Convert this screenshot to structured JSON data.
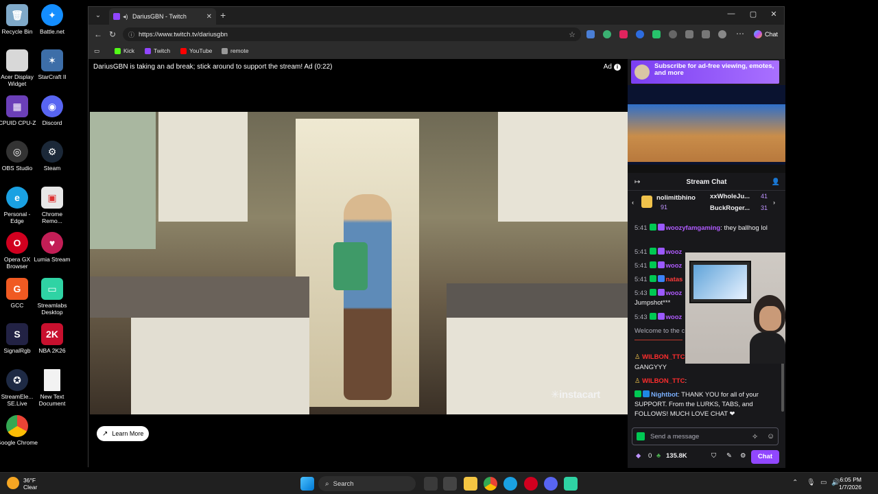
{
  "desktop": {
    "icons": [
      {
        "label": "Recycle Bin",
        "color": "#7fa9c9"
      },
      {
        "label": "Battle.net",
        "color": "#148eff"
      },
      {
        "label": "Acer Display Widget",
        "color": "#d8d8d8"
      },
      {
        "label": "StarCraft II",
        "color": "#3d6ea8"
      },
      {
        "label": "CPUID CPU-Z",
        "color": "#6b3fb8"
      },
      {
        "label": "Discord",
        "color": "#5865f2"
      },
      {
        "label": "OBS Studio",
        "color": "#333333"
      },
      {
        "label": "Steam",
        "color": "#1b2838"
      },
      {
        "label": "Personal - Edge",
        "color": "#1aa1e2"
      },
      {
        "label": "Chrome Remo...",
        "color": "#e8e8e8"
      },
      {
        "label": "Opera GX Browser",
        "color": "#d1001f"
      },
      {
        "label": "Lumia Stream",
        "color": "#c21e56"
      },
      {
        "label": "GCC",
        "color": "#f05a22"
      },
      {
        "label": "Streamlabs Desktop",
        "color": "#2fd3a4"
      },
      {
        "label": "SignalRgb",
        "color": "#222244"
      },
      {
        "label": "NBA 2K26",
        "color": "#c8102e"
      },
      {
        "label": "StreamEle... SE.Live",
        "color": "#1e2a44"
      },
      {
        "label": "New Text Document",
        "color": "#f2f2f2"
      },
      {
        "label": "Google Chrome",
        "color": "#1a73e8"
      }
    ]
  },
  "browser": {
    "tab_title": "DariusGBN - Twitch",
    "url": "https://www.twitch.tv/dariusgbn",
    "chat_button": "Chat",
    "bookmarks": [
      {
        "label": "Kick",
        "color": "#53fc18"
      },
      {
        "label": "Twitch",
        "color": "#9146ff"
      },
      {
        "label": "YouTube",
        "color": "#ff0000"
      },
      {
        "label": "remote",
        "color": "#999999"
      }
    ]
  },
  "player": {
    "ad_message": "DariusGBN is taking an ad break; stick around to support the stream! Ad (0:22)",
    "ad_label": "Ad",
    "brand": "✳instacart",
    "learn_more": "Learn More"
  },
  "chat": {
    "subscribe_banner": "Subscribe for ad-free viewing, emotes, and more",
    "header": "Stream Chat",
    "leaderboard": {
      "top": {
        "name": "nolimitbhino",
        "count": "91"
      },
      "second": {
        "name": "xxWholeJu...",
        "count": "41"
      },
      "third": {
        "name": "BuckRoger...",
        "count": "31"
      }
    },
    "messages": [
      {
        "time": "5:41",
        "user": "woozyfamgaming",
        "text": ": they ballhog lol",
        "color": "#b05bff"
      },
      {
        "time": "5:41",
        "user": "wooz",
        "text": "",
        "color": "#b05bff"
      },
      {
        "time": "5:41",
        "user": "wooz",
        "text": "",
        "color": "#b05bff"
      },
      {
        "time": "5:41",
        "user": "natas",
        "text": "",
        "color": "#ff3b3b"
      },
      {
        "time": "5:43",
        "user": "wooz",
        "text": "",
        "color": "#b05bff"
      },
      {
        "time": "",
        "user": "",
        "text": "Jumpshot***",
        "color": "#efeff1"
      },
      {
        "time": "5:43",
        "user": "wooz",
        "text": "",
        "color": "#b05bff"
      },
      {
        "time": "",
        "user": "",
        "text": "Welcome to the c",
        "color": "#adadb8"
      },
      {
        "time": "",
        "user": "WILBON_TTC",
        "text": "",
        "color": "#ff2d2d"
      },
      {
        "time": "",
        "user": "",
        "text": "GANGYYY",
        "color": "#efeff1"
      },
      {
        "time": "",
        "user": "WILBON_TTC",
        "text": ":",
        "color": "#ff2d2d"
      },
      {
        "time": "",
        "user": "Nightbot",
        "text": ": THANK YOU for all of your SUPPORT. From the LURKS, TABS, and FOLLOWS! MUCH LOVE CHAT ❤",
        "color": "#7ab0ff"
      }
    ],
    "input_placeholder": "Send a message",
    "points": "0",
    "channel_points": "135.8K",
    "send_label": "Chat"
  },
  "taskbar": {
    "temperature": "36°F",
    "condition": "Clear",
    "search_label": "Search",
    "time": "6:05 PM",
    "date": "1/7/2026"
  }
}
